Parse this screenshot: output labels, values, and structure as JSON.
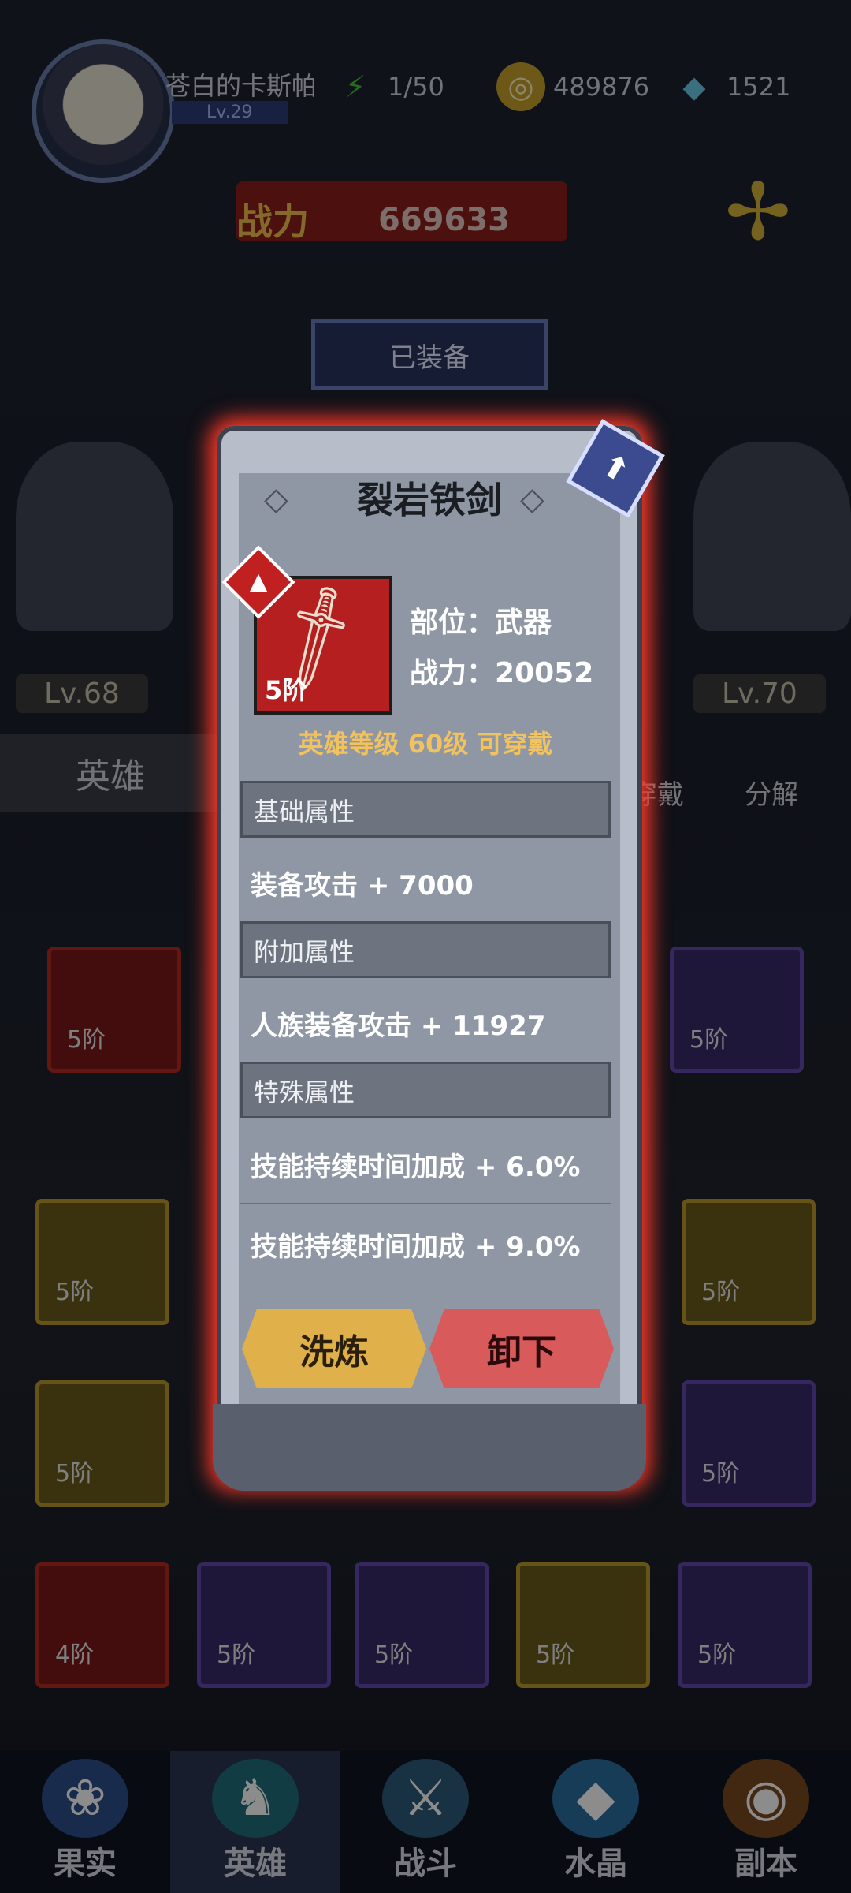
{
  "header": {
    "player_name": "苍白的卡斯帕",
    "level": "Lv.29",
    "energy": "1/50",
    "gold": "489876",
    "diamonds": "1521",
    "power_label": "战力",
    "power_value": "669633"
  },
  "equipped_banner": "已装备",
  "background": {
    "hero_levels": [
      "Lv.68",
      "Lv.70"
    ],
    "hero_tab": "英雄",
    "actions": [
      "穿戴",
      "分解"
    ],
    "slot_tiers": [
      "5阶",
      "5阶",
      "5阶",
      "5阶",
      "5阶",
      "5阶",
      "5阶",
      "5阶",
      "4阶",
      "5阶",
      "5阶",
      "5阶",
      "5阶"
    ]
  },
  "modal": {
    "title": "裂岩铁剑",
    "item_tier": "5阶",
    "part": "部位：武器",
    "power": "战力：20052",
    "requirement": "英雄等级  60级  可穿戴",
    "sections": {
      "basic": "基础属性",
      "extra": "附加属性",
      "special": "特殊属性"
    },
    "attrs": {
      "basic_attack": "装备攻击 + 7000",
      "race_attack": "人族装备攻击 + 11927",
      "skill_duration_1": "技能持续时间加成 + 6.0%",
      "skill_duration_2": "技能持续时间加成 + 9.0%"
    },
    "buttons": {
      "refine": "洗炼",
      "unequip": "卸下"
    }
  },
  "nav": {
    "items": [
      "果实",
      "英雄",
      "战斗",
      "水晶",
      "副本"
    ],
    "active": "英雄"
  },
  "icons": [
    "energy-icon",
    "coin-icon",
    "diamond-icon",
    "pinwheel-icon",
    "sword-icon",
    "lock-badge-icon"
  ],
  "colors": {
    "modal_glow": "#ff3a2a",
    "requirement_text": "#f1c25e",
    "item_red": "#b61f1f"
  }
}
